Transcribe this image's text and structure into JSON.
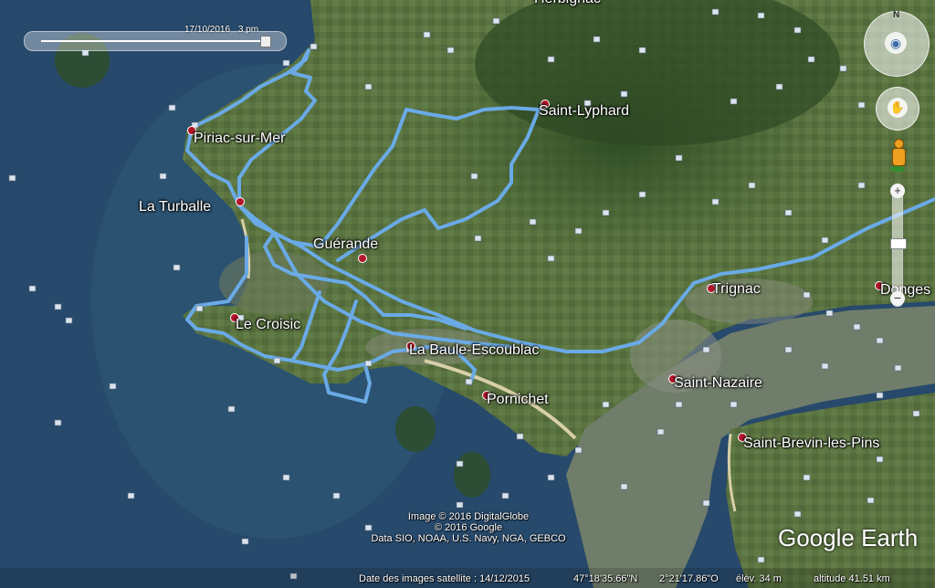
{
  "time_slider": {
    "date": "17/10/2016",
    "hour": "3 pm"
  },
  "places": [
    {
      "name": "Saint-Lyphard",
      "id": "saint-lyphard"
    },
    {
      "name": "Piriac-sur-Mer",
      "id": "piriac-sur-mer"
    },
    {
      "name": "La Turballe",
      "id": "la-turballe"
    },
    {
      "name": "Guérande",
      "id": "guerande"
    },
    {
      "name": "Trignac",
      "id": "trignac"
    },
    {
      "name": "Le Croisic",
      "id": "le-croisic"
    },
    {
      "name": "La Baule-Escoublac",
      "id": "la-baule-escoublac"
    },
    {
      "name": "Saint-Nazaire",
      "id": "saint-nazaire"
    },
    {
      "name": "Pornichet",
      "id": "pornichet"
    },
    {
      "name": "Saint-Brevin-les-Pins",
      "id": "saint-brevin-les-pins"
    },
    {
      "name": "Donges",
      "id": "donges"
    },
    {
      "name": "Herbignac",
      "id": "herbignac"
    }
  ],
  "copyright": {
    "line1": "Image © 2016 DigitalGlobe",
    "line2": "© 2016 Google",
    "line3": "Data SIO, NOAA, U.S. Navy, NGA, GEBCO"
  },
  "status": {
    "imagery_date": "Date des images satellite : 14/12/2015",
    "lat": "47°18'35.66\"N",
    "lon": "2°21'17.86\"O",
    "elev": "élév.   34 m",
    "altitude": "altitude   41.51 km"
  },
  "logo": "Google Earth",
  "colors": {
    "track": "#6aaae6",
    "sea": "#27496b",
    "land": "#4f6a39"
  }
}
